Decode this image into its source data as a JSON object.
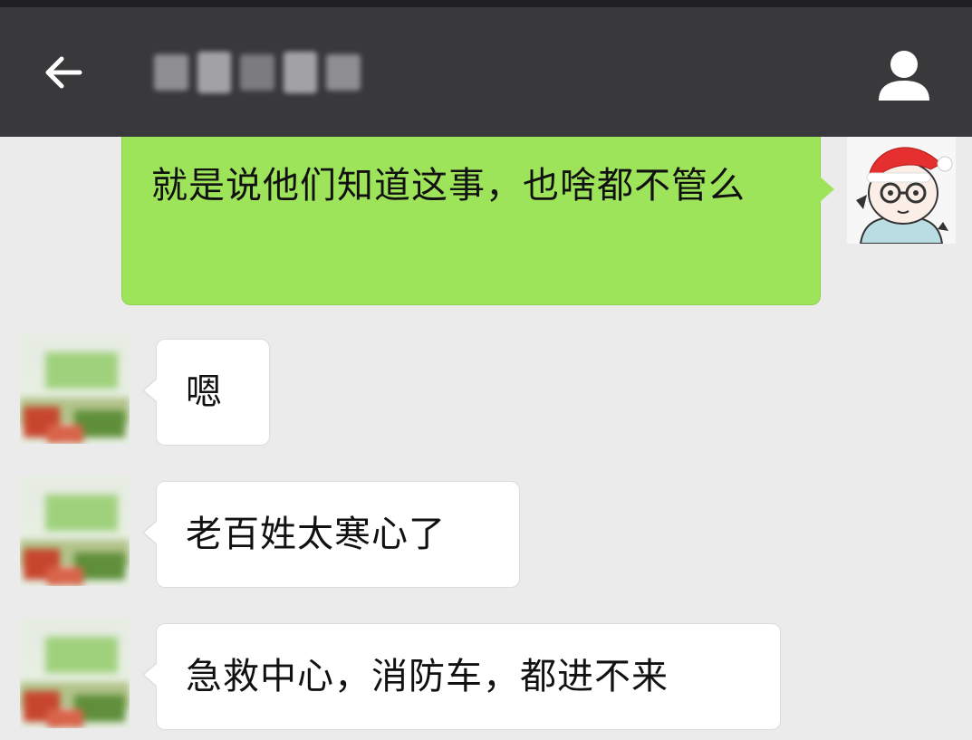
{
  "header": {
    "title": "",
    "back_icon": "arrow-left-icon",
    "profile_icon": "person-icon"
  },
  "colors": {
    "header_bg": "#39393b",
    "chat_bg": "#ebebeb",
    "outgoing_bubble": "#9ee45b",
    "incoming_bubble": "#ffffff"
  },
  "messages": [
    {
      "direction": "outgoing",
      "text": "就是说他们知道这事，也啥都不管么"
    },
    {
      "direction": "incoming",
      "text": "嗯"
    },
    {
      "direction": "incoming",
      "text": "老百姓太寒心了"
    },
    {
      "direction": "incoming",
      "text": "急救中心，消防车，都进不来"
    }
  ]
}
